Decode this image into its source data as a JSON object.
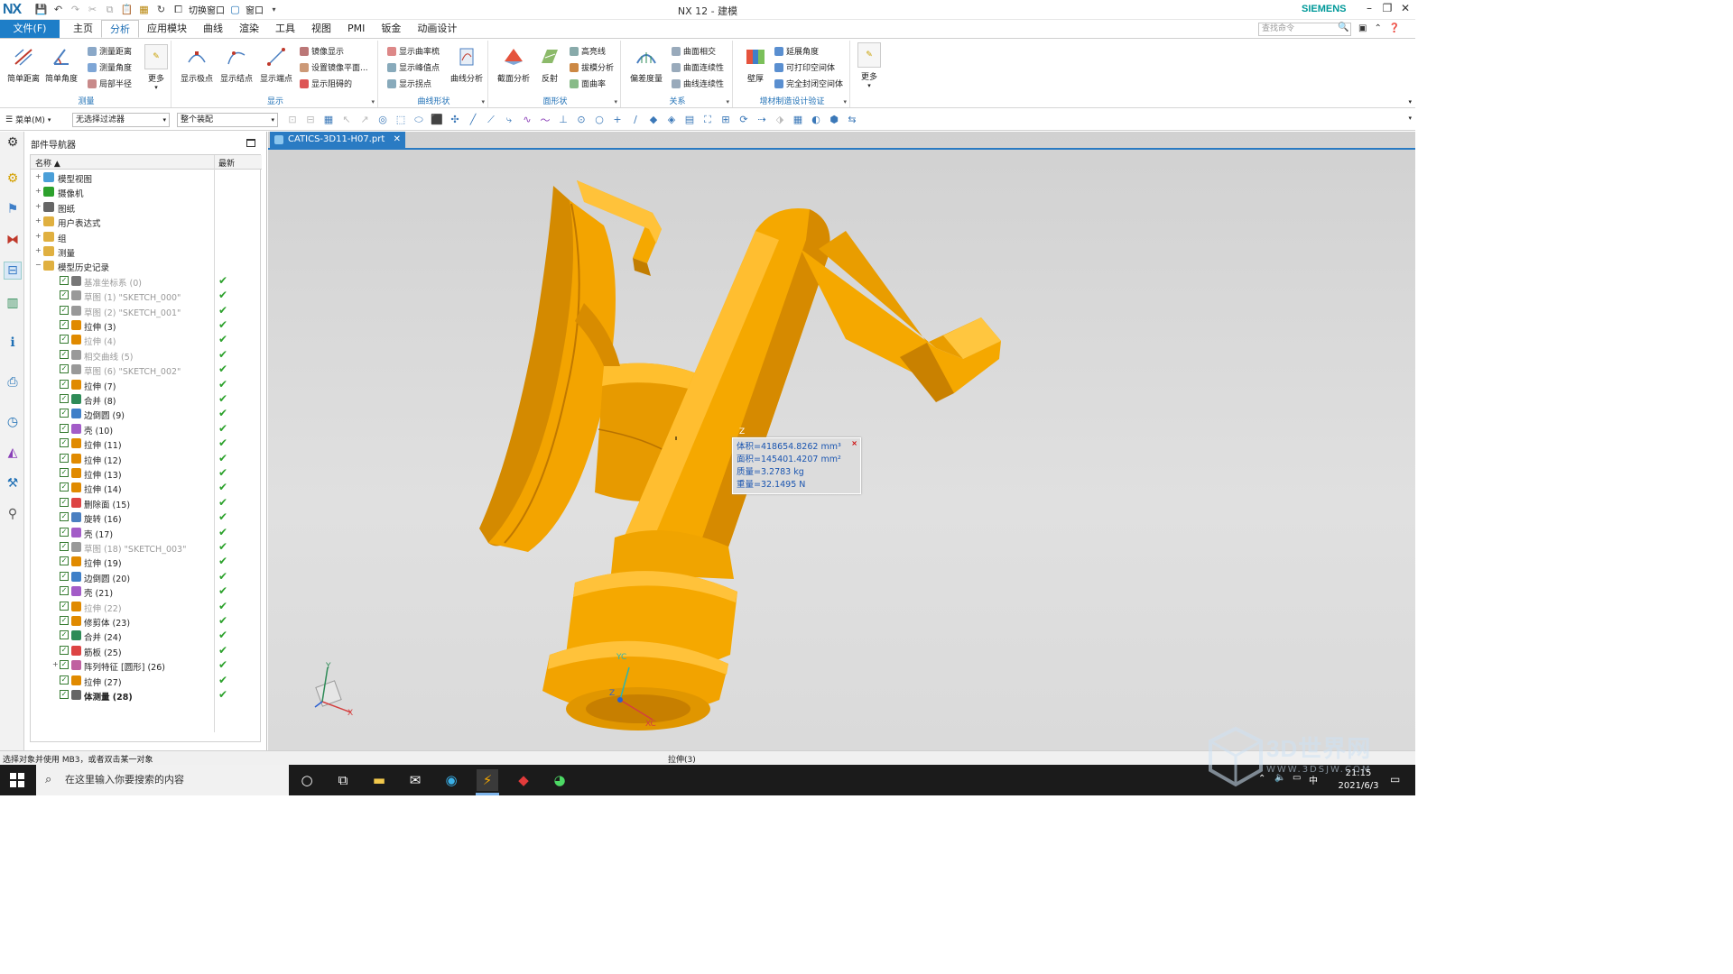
{
  "titlebar": {
    "logo": "NX",
    "switch_window": "切换窗口",
    "window_menu": "窗口",
    "title": "NX 12 - 建模",
    "brand": "SIEMENS"
  },
  "menubar": {
    "file": "文件(F)",
    "tabs": [
      "主页",
      "分析",
      "应用模块",
      "曲线",
      "渲染",
      "工具",
      "视图",
      "PMI",
      "钣金",
      "动画设计"
    ],
    "active_tab": "分析",
    "search_placeholder": "查找命令"
  },
  "ribbon": {
    "measure": {
      "label": "测量",
      "simple_distance": "简单距离",
      "simple_angle": "简单角度",
      "small_items": [
        "测量距离",
        "测量角度",
        "局部半径"
      ],
      "more": "更多"
    },
    "display": {
      "label": "显示",
      "big_items": [
        "显示极点",
        "显示结点",
        "显示端点"
      ],
      "small_items": [
        "镜像显示",
        "设置镜像平面...",
        "显示阻碍的"
      ]
    },
    "curve_shape": {
      "label": "曲线形状",
      "small_items": [
        "显示曲率梳",
        "显示峰值点",
        "显示拐点"
      ],
      "curve_analysis": "曲线分析"
    },
    "face_shape": {
      "label": "面形状",
      "section_analysis": "截面分析",
      "reflection": "反射",
      "small_items": [
        "高亮线",
        "拔模分析",
        "面曲率"
      ]
    },
    "relation": {
      "label": "关系",
      "deviation": "偏差度量",
      "small_items": [
        "曲面相交",
        "曲面连续性",
        "曲线连续性"
      ]
    },
    "additive": {
      "label": "增材制造设计验证",
      "wall_thickness": "壁厚",
      "small_items": [
        "延展角度",
        "可打印空间体",
        "完全封闭空间体"
      ],
      "more": "更多"
    }
  },
  "toolbar2": {
    "menu": "菜单(M)",
    "filter": "无选择过滤器",
    "assembly": "整个装配"
  },
  "navigator": {
    "title": "部件导航器",
    "col_name": "名称",
    "col_latest": "最新",
    "top_nodes": [
      "模型视图",
      "摄像机",
      "图纸",
      "用户表达式",
      "组",
      "测量",
      "模型历史记录"
    ],
    "features": [
      {
        "label": "基准坐标系 (0)",
        "gray": true
      },
      {
        "label": "草图 (1) \"SKETCH_000\"",
        "gray": true
      },
      {
        "label": "草图 (2) \"SKETCH_001\"",
        "gray": true
      },
      {
        "label": "拉伸 (3)",
        "gray": false
      },
      {
        "label": "拉伸 (4)",
        "gray": true
      },
      {
        "label": "相交曲线 (5)",
        "gray": true
      },
      {
        "label": "草图 (6) \"SKETCH_002\"",
        "gray": true
      },
      {
        "label": "拉伸 (7)",
        "gray": false
      },
      {
        "label": "合并 (8)",
        "gray": false
      },
      {
        "label": "边倒圆 (9)",
        "gray": false
      },
      {
        "label": "壳 (10)",
        "gray": false
      },
      {
        "label": "拉伸 (11)",
        "gray": false
      },
      {
        "label": "拉伸 (12)",
        "gray": false
      },
      {
        "label": "拉伸 (13)",
        "gray": false
      },
      {
        "label": "拉伸 (14)",
        "gray": false
      },
      {
        "label": "删除面 (15)",
        "gray": false
      },
      {
        "label": "旋转 (16)",
        "gray": false
      },
      {
        "label": "壳 (17)",
        "gray": false
      },
      {
        "label": "草图 (18) \"SKETCH_003\"",
        "gray": true
      },
      {
        "label": "拉伸 (19)",
        "gray": false
      },
      {
        "label": "边倒圆 (20)",
        "gray": false
      },
      {
        "label": "壳 (21)",
        "gray": false
      },
      {
        "label": "拉伸 (22)",
        "gray": true
      },
      {
        "label": "修剪体 (23)",
        "gray": false
      },
      {
        "label": "合并 (24)",
        "gray": false
      },
      {
        "label": "筋板 (25)",
        "gray": false
      },
      {
        "label": "阵列特征 [圆形] (26)",
        "gray": false
      },
      {
        "label": "拉伸 (27)",
        "gray": false
      },
      {
        "label": "体测量 (28)",
        "gray": false,
        "bold": true
      }
    ]
  },
  "viewport": {
    "tab": "CATICS-3D11-H07.prt",
    "measurement": [
      "体积=418654.8262 mm³",
      "面积=145401.4207 mm²",
      "质量=3.2783 kg",
      "重量=32.1495 N"
    ],
    "axis_labels": {
      "y": "Y",
      "x": "X",
      "yc": "YC",
      "xc": "XC",
      "z": "Z"
    },
    "model_color": "#f5a800"
  },
  "status": {
    "left": "选择对象并使用 MB3，或者双击某一对象",
    "center": "拉伸(3)"
  },
  "taskbar": {
    "search": "在这里输入你要搜索的内容",
    "time": "21:15",
    "date": "2021/6/3",
    "ime": "中"
  },
  "watermark": {
    "title": "3D世界网",
    "url": "WWW.3DSJW.COM"
  }
}
